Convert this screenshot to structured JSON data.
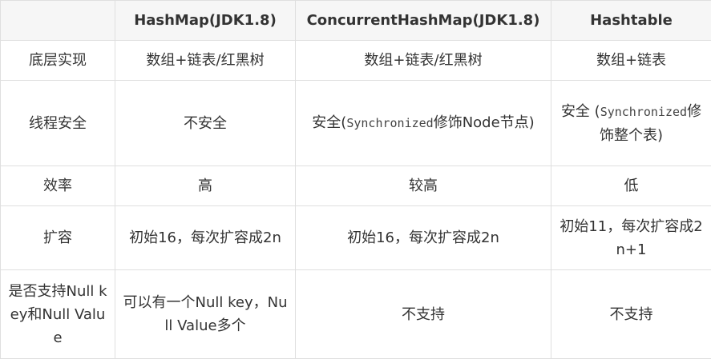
{
  "header": {
    "corner": "",
    "col1": "HashMap(JDK1.8)",
    "col2": "ConcurrentHashMap(JDK1.8)",
    "col3": "Hashtable"
  },
  "rows": [
    {
      "label": "底层实现",
      "hashmap": "数组+链表/红黑树",
      "concurrent": "数组+链表/红黑树",
      "hashtable": "数组+链表"
    },
    {
      "label": "线程安全",
      "hashmap": "不安全",
      "concurrent": {
        "before": "安全(",
        "code": "Synchronized",
        "after": "修饰Node节点)"
      },
      "hashtable": {
        "before": "安全 (",
        "code": "Synchronized",
        "after": "修饰整个表)"
      }
    },
    {
      "label": "效率",
      "hashmap": "高",
      "concurrent": "较高",
      "hashtable": "低"
    },
    {
      "label": "扩容",
      "hashmap": "初始16，每次扩容成2n",
      "concurrent": "初始16，每次扩容成2n",
      "hashtable": "初始11，每次扩容成2n+1"
    },
    {
      "label": "是否支持Null key和Null Value",
      "hashmap": "可以有一个Null key，Null Value多个",
      "concurrent": "不支持",
      "hashtable": "不支持"
    }
  ]
}
